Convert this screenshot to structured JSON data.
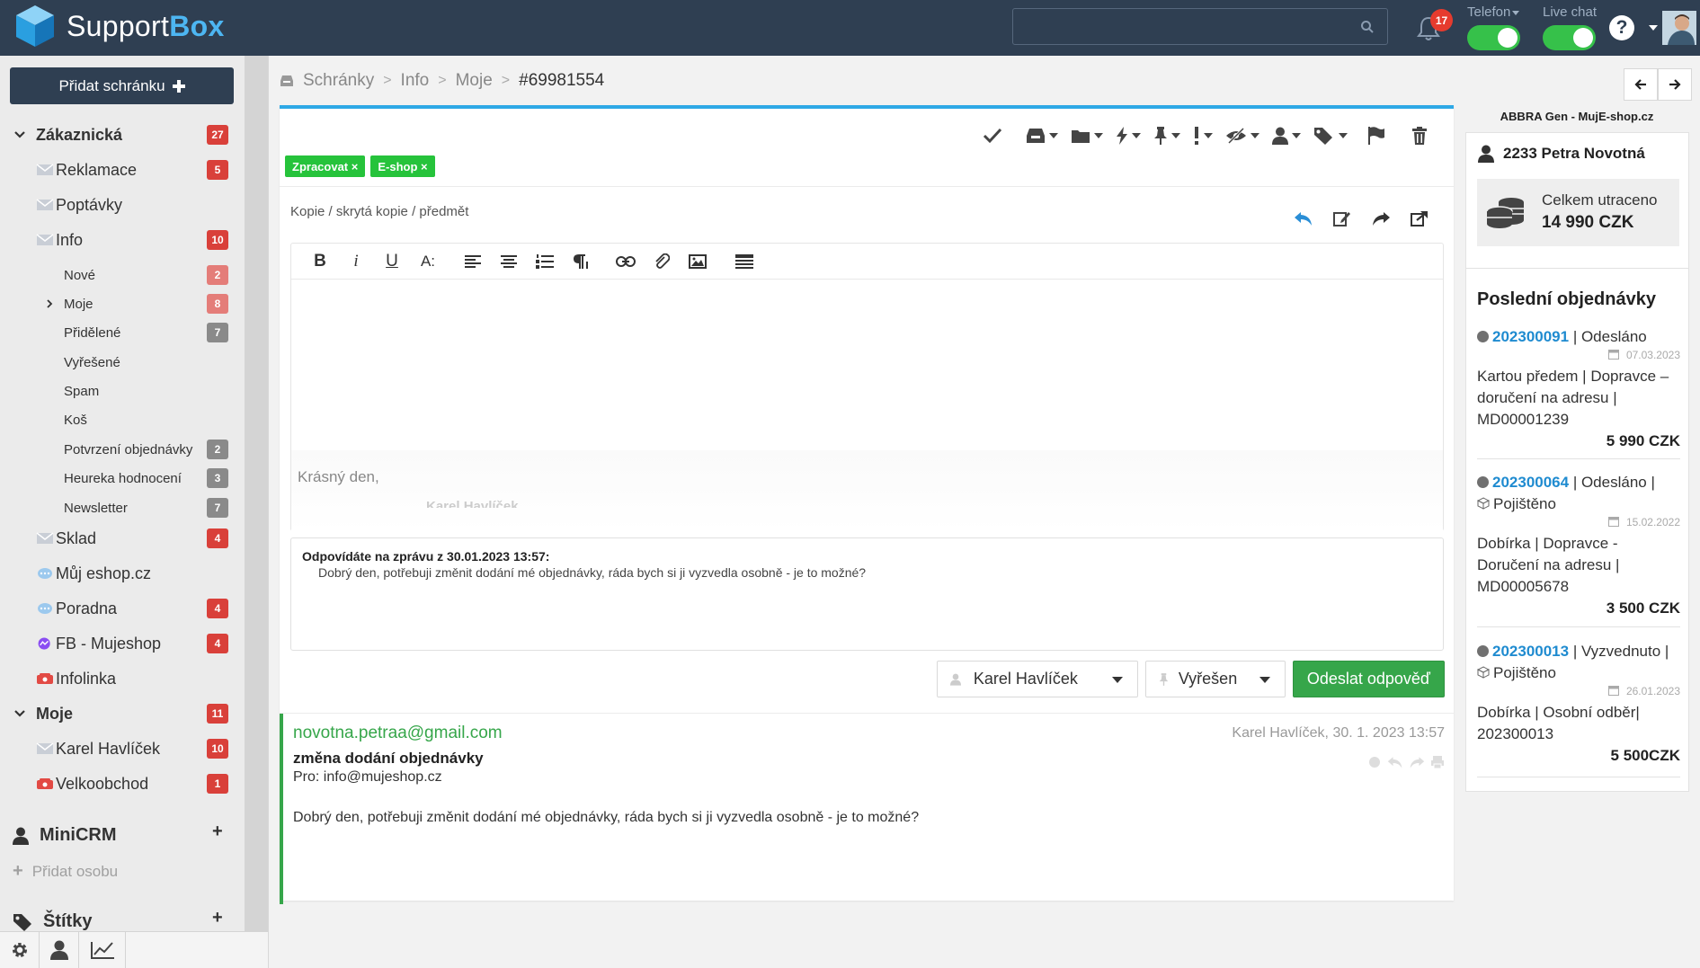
{
  "app": {
    "name_main": "Support",
    "name_bold": "Box"
  },
  "header": {
    "search_placeholder": "",
    "notifications_count": "17",
    "toggles": [
      {
        "label": "Telefon",
        "on": true
      },
      {
        "label": "Live chat",
        "on": true
      }
    ],
    "help_label": "?"
  },
  "sidebar": {
    "add_inbox_label": "Přidat schránku",
    "groups": {
      "customer_label": "Zákaznická",
      "customer_count": "27",
      "mine_label": "Moje",
      "mine_count": "11"
    },
    "items": {
      "reklamace": {
        "label": "Reklamace",
        "count": "5"
      },
      "poptavky": {
        "label": "Poptávky"
      },
      "info": {
        "label": "Info",
        "count": "10"
      },
      "nove": {
        "label": "Nové",
        "count": "2"
      },
      "moje": {
        "label": "Moje",
        "count": "8"
      },
      "pridelene": {
        "label": "Přidělené",
        "count": "7"
      },
      "vyresene": {
        "label": "Vyřešené"
      },
      "spam": {
        "label": "Spam"
      },
      "kos": {
        "label": "Koš"
      },
      "potvrzeni": {
        "label": "Potvrzení objednávky",
        "count": "2"
      },
      "heureka": {
        "label": "Heureka hodnocení",
        "count": "3"
      },
      "newsletter": {
        "label": "Newsletter",
        "count": "7"
      },
      "sklad": {
        "label": "Sklad",
        "count": "4"
      },
      "eshop": {
        "label": "Můj eshop.cz"
      },
      "poradna": {
        "label": "Poradna",
        "count": "4"
      },
      "fb": {
        "label": "FB - Mujeshop",
        "count": "4"
      },
      "infolinka": {
        "label": "Infolinka"
      },
      "karel": {
        "label": "Karel Havlíček",
        "count": "10"
      },
      "velkoobchod": {
        "label": "Velkoobchod",
        "count": "1"
      }
    },
    "minicrm_label": "MiniCRM",
    "add_person_label": "Přidat osobu",
    "tags_label": "Štítky"
  },
  "breadcrumb": {
    "items": [
      "Schránky",
      "Info",
      "Moje"
    ],
    "current": "#69981554",
    "sep": ">"
  },
  "ticket": {
    "tags": [
      "Zpracovat ×",
      "E-shop ×"
    ],
    "copy_link": "Kopie / skrytá kopie / předmět",
    "editor": {
      "toolbar": [
        "B",
        "i",
        "U",
        "A:",
        "align-left",
        "align-center",
        "list-ol",
        "paragraph",
        "link",
        "attach",
        "image",
        "template"
      ],
      "signature": "Krásný den,",
      "signature_cut": "Karel Havlíček"
    },
    "quoted": {
      "title": "Odpovídáte na zprávu z 30.01.2023 13:57:",
      "body": "Dobrý den, potřebuji změnit dodání mé objednávky, ráda bych si ji vyzvedla osobně - je to možné?"
    },
    "assignee": "Karel Havlíček",
    "status": "Vyřešen",
    "send_label": "Odeslat odpověď",
    "message": {
      "from": "novotna.petraa@gmail.com",
      "meta": "Karel Havlíček, 30. 1. 2023 13:57",
      "subject": "změna dodání objednávky",
      "to": "Pro: info@mujeshop.cz",
      "body": "Dobrý den, potřebuji změnit dodání mé objednávky, ráda bych si ji vyzvedla osobně - je to možné?"
    }
  },
  "right_panel": {
    "title": "ABBRA Gen - MujE-shop.cz",
    "customer": "2233 Petra Novotná",
    "spent_label": "Celkem utraceno",
    "spent_value": "14 990 CZK",
    "orders_heading": "Poslední objednávky",
    "orders": [
      {
        "num": "202300091",
        "status": " | Odesláno",
        "date": "07.03.2023",
        "detail": "Kartou předem | Dopravce – doručení na adresu | MD00001239",
        "price": "5 990 CZK"
      },
      {
        "num": "202300064",
        "status": " | Odesláno | ",
        "extra": "Pojištěno",
        "date": "15.02.2022",
        "detail": "Dobírka | Dopravce - Doručení na adresu | MD00005678",
        "price": "3 500 CZK"
      },
      {
        "num": "202300013",
        "status": " | Vyzvednuto | ",
        "extra": "Pojištěno",
        "date": "26.01.2023",
        "detail": "Dobírka | Osobní odběr| 202300013",
        "price": "5 500CZK"
      }
    ]
  },
  "colors": {
    "topbar": "#2f3f52",
    "accent_blue": "#2ea8e6",
    "green": "#36a64a",
    "badge_red": "#d9403a",
    "link_blue": "#1f8bd0"
  },
  "icons": [
    "logo-cube-icon",
    "search-icon",
    "bell-icon",
    "help-icon",
    "chevron-down-icon",
    "chevron-right-icon",
    "envelope-icon",
    "chat-icon",
    "messenger-icon",
    "phone-icon",
    "user-icon",
    "tag-icon",
    "gear-icon",
    "chart-icon",
    "check-icon",
    "inbox-icon",
    "folder-icon",
    "bolt-icon",
    "pin-icon",
    "exclamation-icon",
    "eye-slash-icon",
    "flag-icon",
    "trash-icon",
    "reply-icon",
    "edit-icon",
    "forward-icon",
    "share-icon",
    "coins-icon",
    "calendar-icon",
    "box-icon"
  ]
}
